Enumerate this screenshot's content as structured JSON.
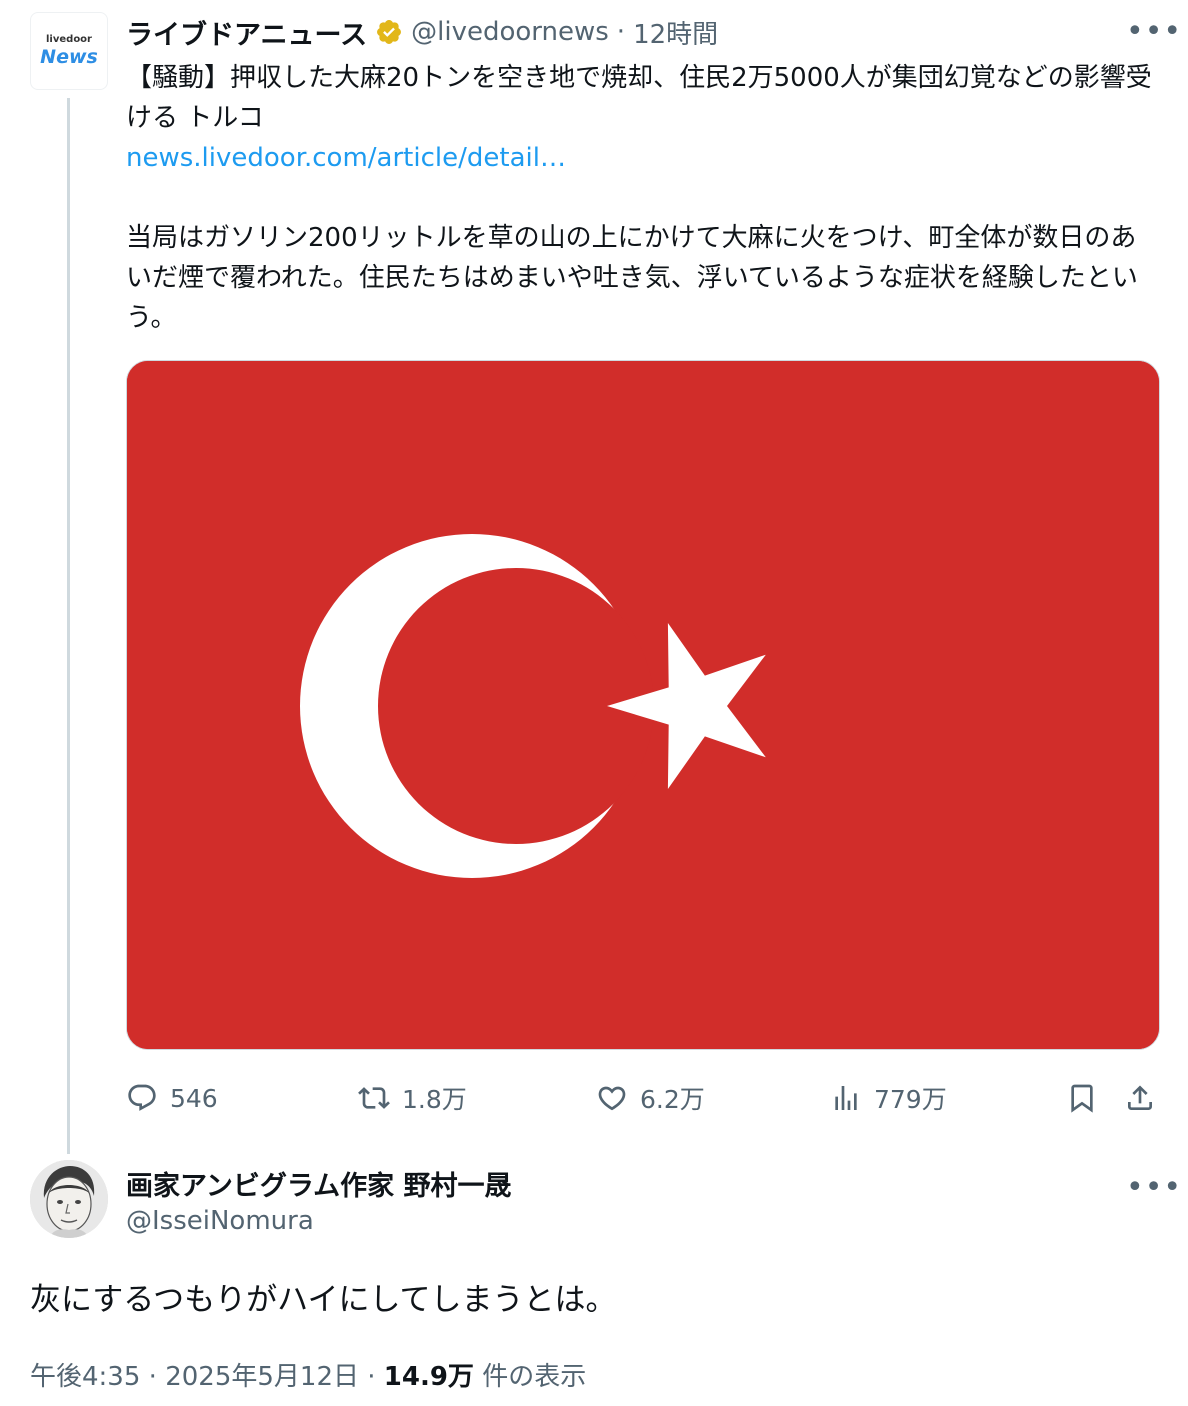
{
  "parent_tweet": {
    "avatar_text_top": "livedoor",
    "avatar_text_bottom": "News",
    "display_name": "ライブドアニュース",
    "handle": "@livedoornews",
    "separator": "·",
    "time": "12時間",
    "more": "•••",
    "text_line1": "【騒動】押収した大麻20トンを空き地で焼却、住民2万5000人が集団幻覚などの影響受ける トルコ",
    "link": "news.livedoor.com/article/detail…",
    "text_para2": "当局はガソリン200リットルを草の山の上にかけて大麻に火をつけ、町全体が数日のあいだ煙で覆われた。住民たちはめまいや吐き気、浮いているような症状を経験したという。",
    "media_colors": {
      "flag_red": "#e30a17",
      "flag_white": "#ffffff"
    },
    "actions": {
      "replies": "546",
      "retweets": "1.8万",
      "likes": "6.2万",
      "views": "779万"
    }
  },
  "reply_tweet": {
    "display_name": "画家アンビグラム作家 野村一晟",
    "handle": "@IsseiNomura",
    "more": "•••",
    "text": "灰にするつもりがハイにしてしまうとは。",
    "time": "午後4:35",
    "separator": "·",
    "date": "2025年5月12日",
    "separator2": "·",
    "view_count": "14.9万",
    "view_label": "件の表示"
  },
  "colors": {
    "accent": "#1d9bf0",
    "secondary_text": "#536471",
    "verified_gold": "#e2b719"
  }
}
